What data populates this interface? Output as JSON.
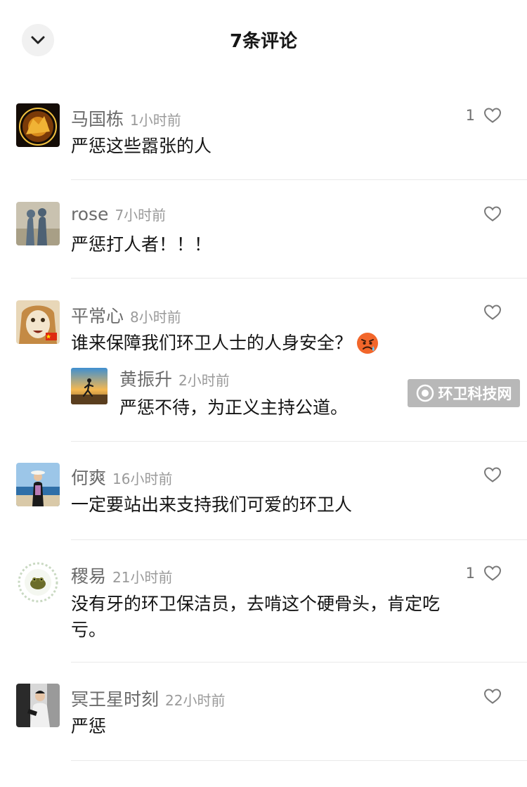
{
  "header": {
    "title": "7条评论",
    "collapse_icon": "chevron-down-icon"
  },
  "comments": [
    {
      "user": "马国栋",
      "time": "1小时前",
      "likes": "1",
      "text": "严惩这些嚣张的人"
    },
    {
      "user": "rose",
      "time": "7小时前",
      "likes": "",
      "text": "严惩打人者！！！"
    },
    {
      "user": "平常心",
      "time": "8小时前",
      "likes": "",
      "text": "谁来保障我们环卫人士的人身安全？",
      "emoji": "angry-face-emoji",
      "reply": {
        "user": "黄振升",
        "time": "2小时前",
        "text": "严惩不待，为正义主持公道。"
      }
    },
    {
      "user": "何爽",
      "time": "16小时前",
      "likes": "",
      "text": "一定要站出来支持我们可爱的环卫人"
    },
    {
      "user": "稷易",
      "time": "21小时前",
      "likes": "1",
      "text_line1": "没有牙的环卫保洁员，去啃这个硬骨头，肯定吃",
      "text_line2": "亏。"
    },
    {
      "user": "冥王星时刻",
      "time": "22小时前",
      "likes": "",
      "text": "严惩"
    }
  ],
  "watermark": {
    "text": "环卫科技网"
  },
  "colors": {
    "background": "#ffffff",
    "username": "#6b6b6b",
    "time": "#9a9a9a",
    "text": "#141414",
    "divider": "#e9e9e9"
  }
}
